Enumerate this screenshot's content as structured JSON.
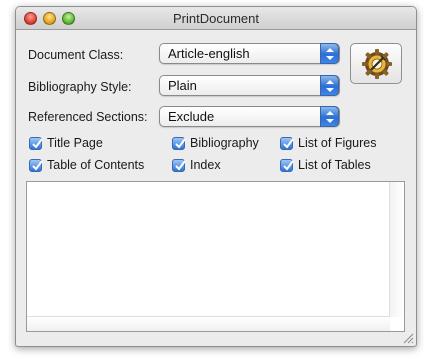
{
  "window": {
    "title": "PrintDocument"
  },
  "fields": {
    "document_class": {
      "label": "Document Class:",
      "value": "Article-english"
    },
    "bibliography_style": {
      "label": "Bibliography Style:",
      "value": "Plain"
    },
    "referenced_sections": {
      "label": "Referenced Sections:",
      "value": "Exclude"
    }
  },
  "checkboxes": [
    {
      "label": "Title Page",
      "checked": true
    },
    {
      "label": "Bibliography",
      "checked": true
    },
    {
      "label": "List of Figures",
      "checked": true
    },
    {
      "label": "Table of Contents",
      "checked": true
    },
    {
      "label": "Index",
      "checked": true
    },
    {
      "label": "List of Tables",
      "checked": true
    }
  ],
  "icons": {
    "action": "gear-compass-icon"
  },
  "colors": {
    "accent": "#2d74da"
  }
}
